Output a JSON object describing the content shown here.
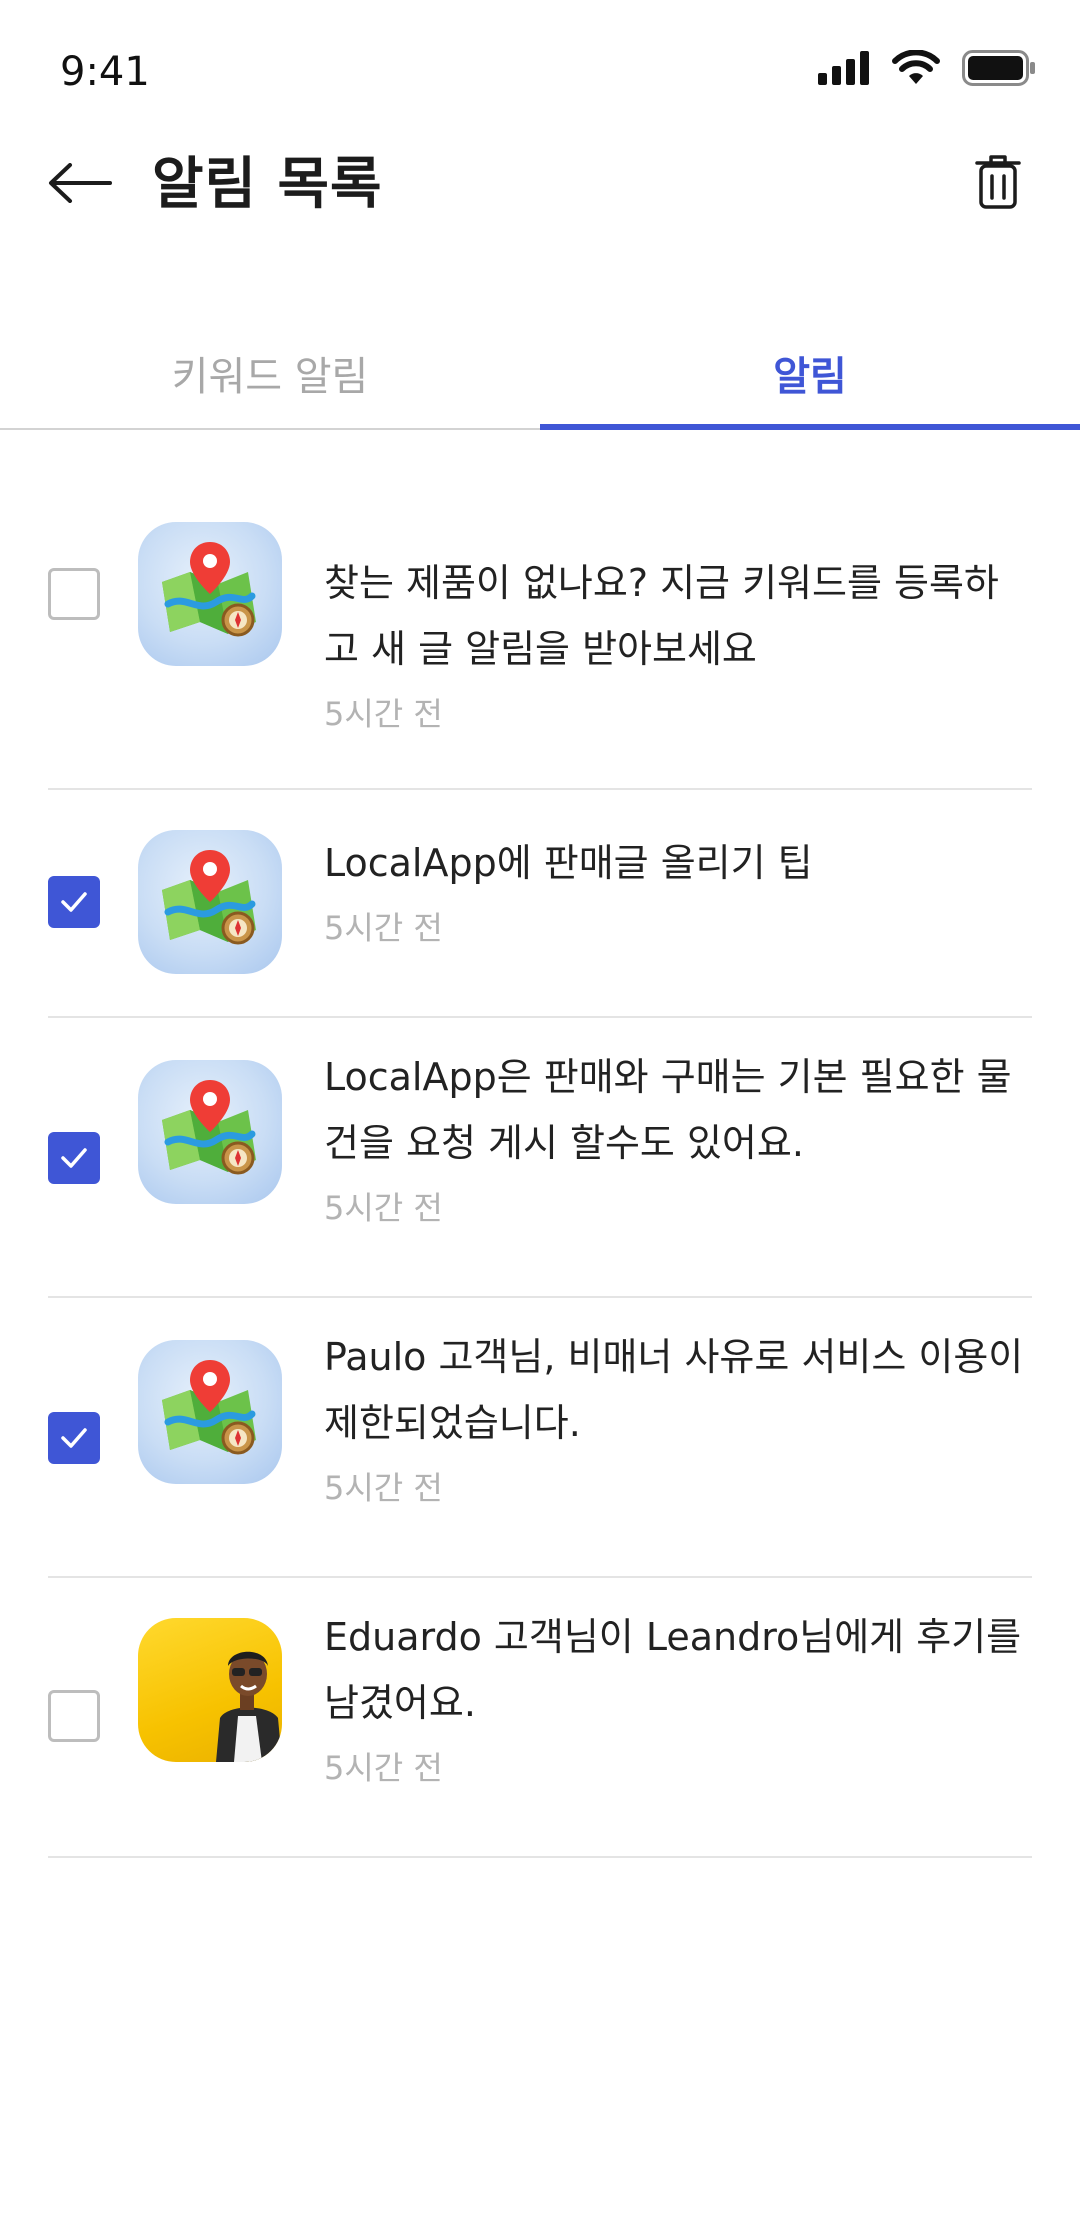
{
  "status_bar": {
    "time": "9:41"
  },
  "header": {
    "title": "알림 목록"
  },
  "tabs": [
    {
      "label": "키워드 알림",
      "active": false
    },
    {
      "label": "알림",
      "active": true
    }
  ],
  "colors": {
    "accent": "#3f56d6",
    "inactive_tab": "#a8a8a8",
    "timestamp": "#b3b3b3"
  },
  "notifications": [
    {
      "checked": false,
      "icon": "map-icon",
      "message": "찾는 제품이 없나요? 지금 키워드를 등록하고 새 글 알림을 받아보세요",
      "time": "5시간 전"
    },
    {
      "checked": true,
      "icon": "map-icon",
      "message": "LocalApp에 판매글 올리기 팁",
      "time": "5시간 전"
    },
    {
      "checked": true,
      "icon": "map-icon",
      "message": "LocalApp은 판매와 구매는 기본 필요한 물건을 요청 게시 할수도 있어요.",
      "time": "5시간 전"
    },
    {
      "checked": true,
      "icon": "map-icon",
      "message": "Paulo 고객님, 비매너 사유로 서비스 이용이 제한되었습니다.",
      "time": "5시간 전"
    },
    {
      "checked": false,
      "icon": "user-photo",
      "message": "Eduardo 고객님이 Leandro님에게 후기를 남겼어요.",
      "time": "5시간 전"
    }
  ]
}
